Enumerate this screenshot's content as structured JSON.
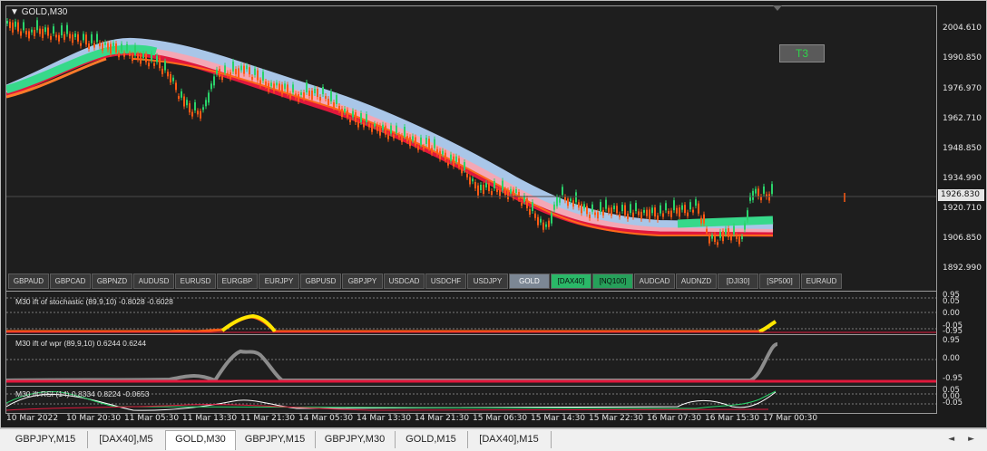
{
  "chart_header": {
    "symbol": "GOLD,M30",
    "marker": "T3"
  },
  "current_price": "1926.830",
  "price_axis": [
    "2004.610",
    "1990.850",
    "1976.970",
    "1962.710",
    "1948.850",
    "1934.990",
    "1920.710",
    "1906.850",
    "1892.990"
  ],
  "symbol_buttons": [
    {
      "label": "GBPAUD",
      "state": "normal"
    },
    {
      "label": "GBPCAD",
      "state": "normal"
    },
    {
      "label": "GBPNZD",
      "state": "normal"
    },
    {
      "label": "AUDUSD",
      "state": "normal"
    },
    {
      "label": "EURUSD",
      "state": "normal"
    },
    {
      "label": "EURGBP",
      "state": "normal"
    },
    {
      "label": "EURJPY",
      "state": "normal"
    },
    {
      "label": "GBPUSD",
      "state": "normal"
    },
    {
      "label": "GBPJPY",
      "state": "normal"
    },
    {
      "label": "USDCAD",
      "state": "normal"
    },
    {
      "label": "USDCHF",
      "state": "normal"
    },
    {
      "label": "USDJPY",
      "state": "normal"
    },
    {
      "label": "GOLD",
      "state": "active"
    },
    {
      "label": "[DAX40]",
      "state": "green"
    },
    {
      "label": "[NQ100]",
      "state": "dgreen"
    },
    {
      "label": "AUDCAD",
      "state": "normal"
    },
    {
      "label": "AUDNZD",
      "state": "normal"
    },
    {
      "label": "[DJI30]",
      "state": "normal"
    },
    {
      "label": "[SP500]",
      "state": "normal"
    },
    {
      "label": "EURAUD",
      "state": "normal"
    }
  ],
  "indicators": [
    {
      "label": "M30 ift of stochastic (89,9,10) -0.8028 -0.6028",
      "levels": [
        "0.95",
        "0.05",
        "0.00",
        "-0.05",
        "-0.95"
      ]
    },
    {
      "label": "M30 ift of wpr (89,9,10) 0.6244 0.6244",
      "levels": [
        "0.95",
        "0.00",
        "-0.95"
      ]
    },
    {
      "label": "M30 ift RSI (14) 0.8334 0.8224 -0.0653",
      "levels": [
        "0.05",
        "0.00",
        "-0.05"
      ]
    }
  ],
  "time_axis": [
    "10 Mar 2022",
    "10 Mar 20:30",
    "11 Mar 05:30",
    "11 Mar 13:30",
    "11 Mar 21:30",
    "14 Mar 05:30",
    "14 Mar 13:30",
    "14 Mar 21:30",
    "15 Mar 06:30",
    "15 Mar 14:30",
    "15 Mar 22:30",
    "16 Mar 07:30",
    "16 Mar 15:30",
    "17 Mar 00:30"
  ],
  "tabs": [
    {
      "label": "GBPJPY,M15",
      "active": false
    },
    {
      "label": "[DAX40],M5",
      "active": false
    },
    {
      "label": "GOLD,M30",
      "active": true
    },
    {
      "label": "GBPJPY,M15",
      "active": false
    },
    {
      "label": "GBPJPY,M30",
      "active": false
    },
    {
      "label": "GOLD,M15",
      "active": false
    },
    {
      "label": "[DAX40],M15",
      "active": false
    }
  ],
  "nav_arrows": "◄ ►",
  "colors": {
    "bull": "#2ad36a",
    "bear": "#ff5a14",
    "band_red": "#e0183c",
    "band_pink": "#f4a7b5",
    "band_blue": "#a9c6e8",
    "band_green": "#37d98a",
    "stoch_line": "#ffe600",
    "wpr_line": "#9a9a9a"
  }
}
